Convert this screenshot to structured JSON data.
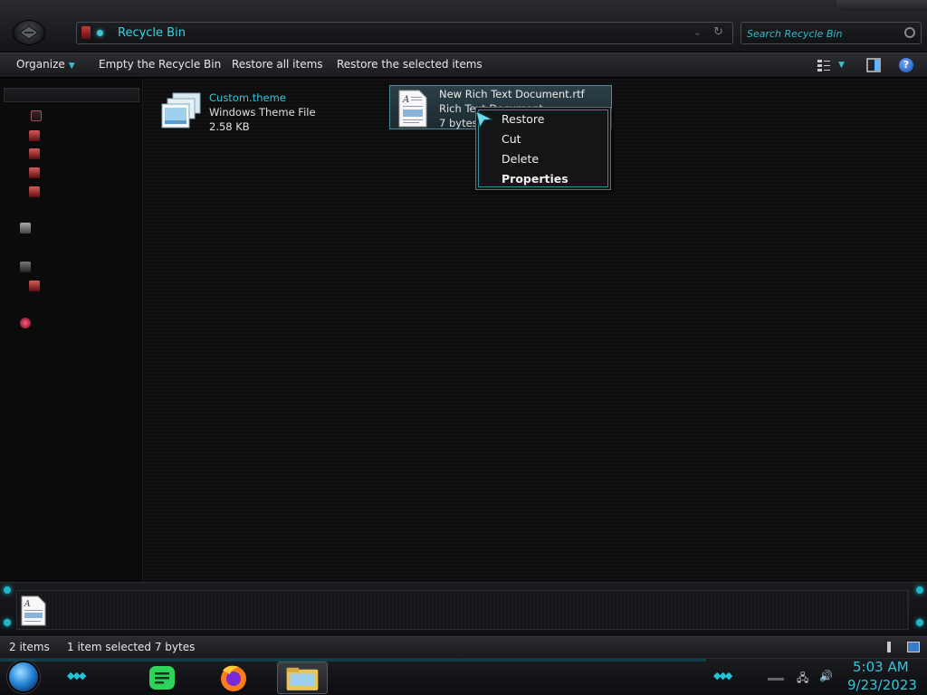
{
  "address": {
    "path": "Recycle Bin"
  },
  "search": {
    "placeholder": "Search Recycle Bin"
  },
  "toolbar": {
    "organize": "Organize",
    "empty": "Empty the Recycle Bin",
    "restore_all": "Restore all items",
    "restore_selected": "Restore the selected items"
  },
  "files": [
    {
      "name": "Custom.theme",
      "type": "Windows Theme File",
      "size": "2.58 KB",
      "icon": "theme-file-icon"
    },
    {
      "name": "New Rich Text Document.rtf",
      "type": "Rich Text Document",
      "size": "7 bytes",
      "icon": "rtf-file-icon",
      "selected": true
    }
  ],
  "context_menu": {
    "items": [
      "Restore",
      "Cut",
      "Delete",
      "Properties"
    ],
    "default_item": "Properties"
  },
  "status": {
    "item_count": "2 items",
    "selection": "1 item selected  7 bytes"
  },
  "clock": {
    "time": "5:03 AM",
    "date": "9/23/2023"
  },
  "colors": {
    "accent": "#35c6d8",
    "background": "#0a0a0b"
  }
}
